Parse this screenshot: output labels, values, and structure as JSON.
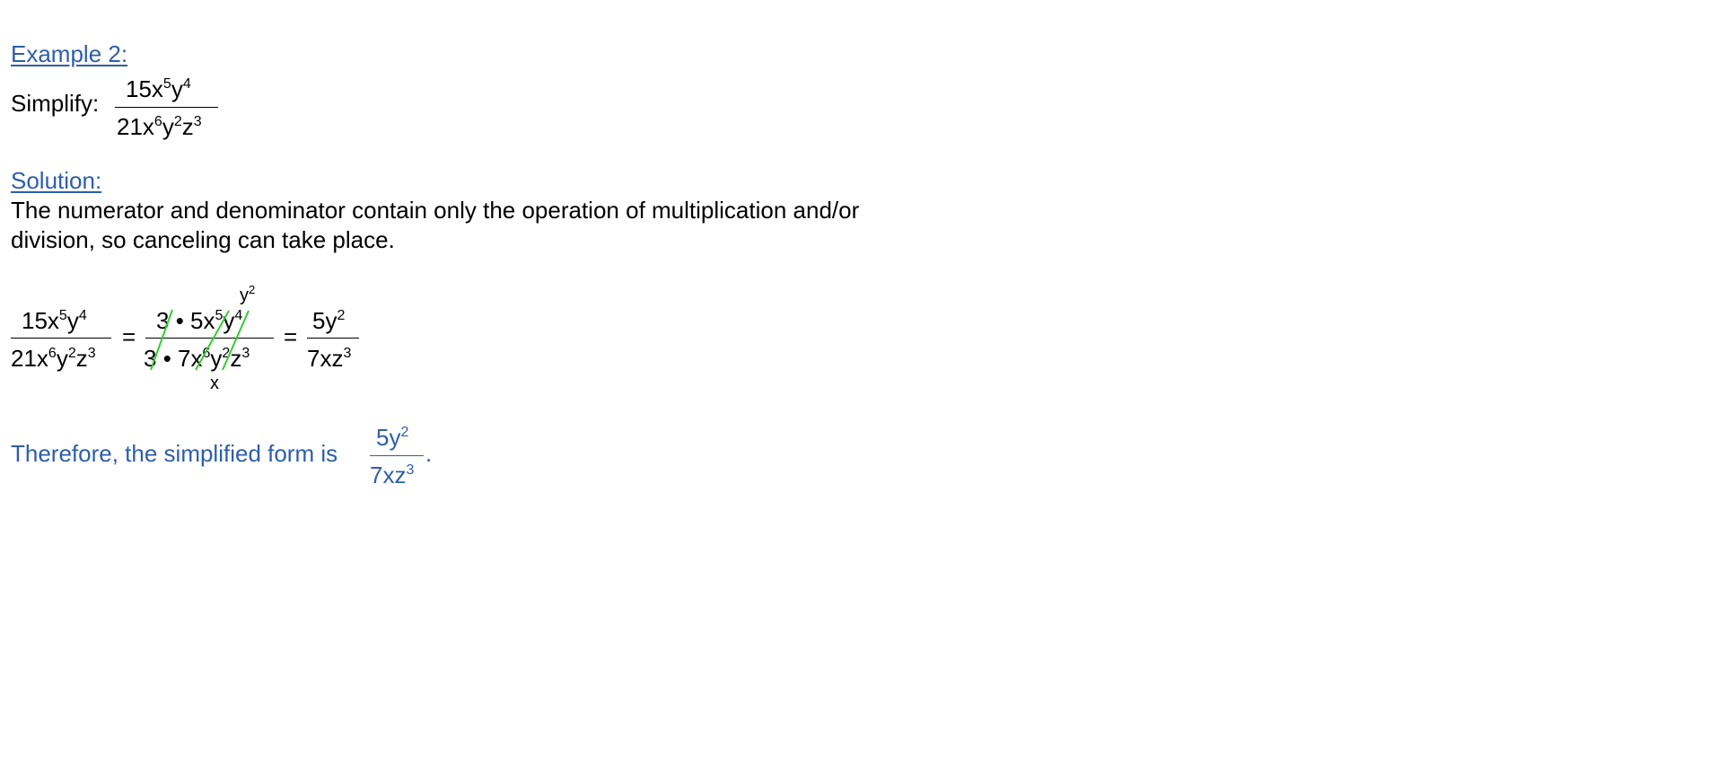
{
  "example": {
    "heading": "Example 2:",
    "simplify_label": "Simplify:",
    "fraction": {
      "num_coef": "15x",
      "num_exp1": "5",
      "num_var2": "y",
      "num_exp2": "4",
      "den_coef": "21x",
      "den_exp1": "6",
      "den_var2": "y",
      "den_exp2": "2",
      "den_var3": "z",
      "den_exp3": "3"
    }
  },
  "solution": {
    "heading": "Solution:",
    "line1": "The numerator and denominator contain only the operation of multiplication and/or",
    "line2": "division, so canceling can take place."
  },
  "work": {
    "left": {
      "num_coef": "15x",
      "num_exp1": "5",
      "num_var2": "y",
      "num_exp2": "4",
      "den_coef": "21x",
      "den_exp1": "6",
      "den_var2": "y",
      "den_exp2": "2",
      "den_var3": "z",
      "den_exp3": "3"
    },
    "equals": "=",
    "middle": {
      "num_a": "3",
      "num_dot": "•",
      "num_b": "5x",
      "num_exp1": "5",
      "num_var2": "y",
      "num_exp2": "4",
      "den_a": "3",
      "den_dot": "•",
      "den_b": "7x",
      "den_exp1": "6",
      "den_var2": "y",
      "den_exp2": "2",
      "den_var3": "z",
      "den_exp3": "3",
      "above_var": "y",
      "above_exp": "2",
      "below_var": "x"
    },
    "right": {
      "num_coef": "5y",
      "num_exp": "2",
      "den_coef": "7xz",
      "den_exp": "3"
    }
  },
  "conclusion": {
    "text": "Therefore, the simplified form is",
    "num_coef": "5y",
    "num_exp": "2",
    "den_coef": "7xz",
    "den_exp": "3",
    "period": "."
  },
  "colors": {
    "heading": "#2e5eaa",
    "cancel_stroke": "#33cc33",
    "text": "#000000"
  }
}
